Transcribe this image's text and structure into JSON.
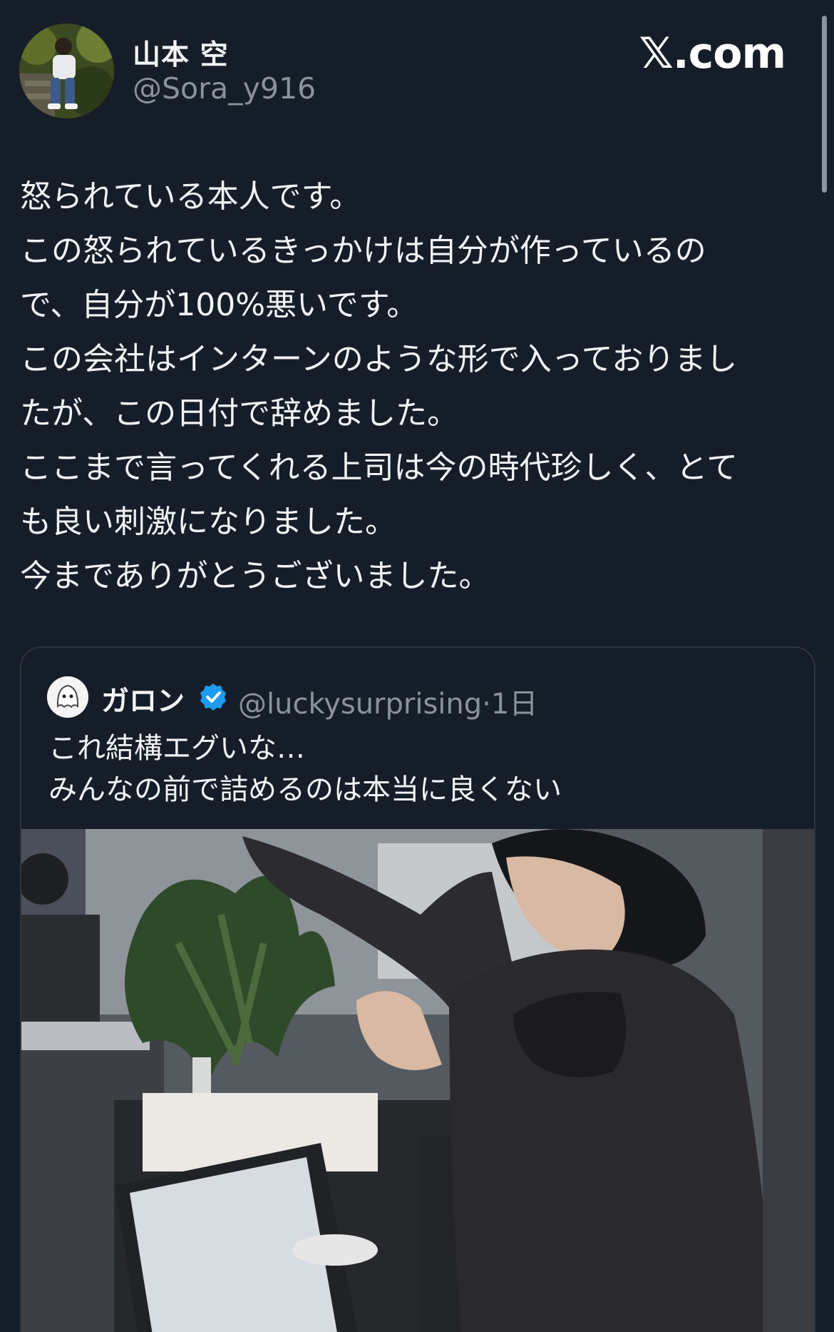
{
  "author": {
    "display_name": "山本 空",
    "handle": "@Sora_y916",
    "avatar_icon": "user-avatar-photo"
  },
  "brand": {
    "label": "𝕏.com"
  },
  "post": {
    "lines": [
      "怒られている本人です。",
      "この怒られているきっかけは自分が作っているの",
      "で、自分が100%悪いです。",
      "この会社はインターンのような形で入っておりまし",
      "たが、この日付で辞めました。",
      "ここまで言ってくれる上司は今の時代珍しく、とて",
      "も良い刺激になりました。",
      "今までありがとうございました。"
    ]
  },
  "quoted_post": {
    "author_name": "ガロン",
    "handle": "@luckysurprising",
    "separator": "·",
    "time": "1日",
    "verified_icon": "verified-badge-icon",
    "lines": [
      "これ結構エグいな…",
      "みんなの前で詰めるのは本当に良くない"
    ],
    "media_icon": "office-photo"
  },
  "colors": {
    "background": "#151d28",
    "text": "#f1f3f6",
    "secondary_text": "#8a929c",
    "verified": "#1d9bf0",
    "border": "#2c3440"
  }
}
